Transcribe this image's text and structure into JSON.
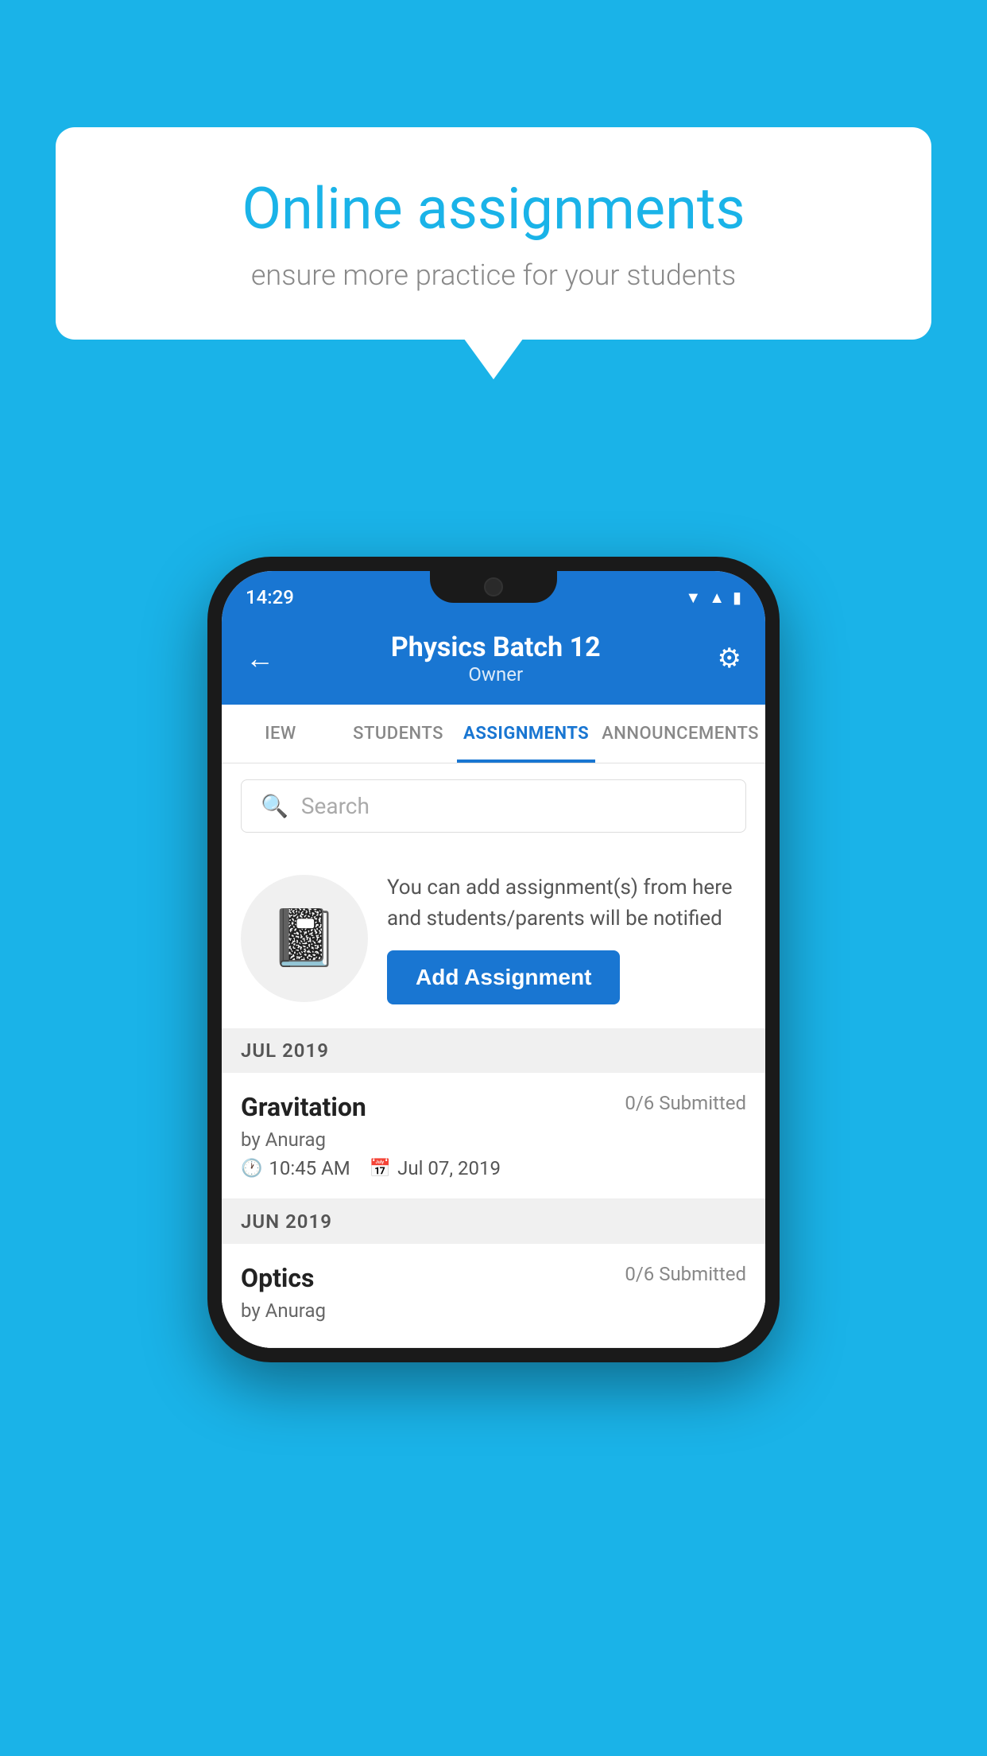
{
  "background_color": "#1ab3e8",
  "speech_bubble": {
    "title": "Online assignments",
    "subtitle": "ensure more practice for your students"
  },
  "phone": {
    "status_bar": {
      "time": "14:29",
      "icons": [
        "wifi",
        "signal",
        "battery"
      ]
    },
    "header": {
      "title": "Physics Batch 12",
      "subtitle": "Owner",
      "back_label": "←",
      "settings_label": "⚙"
    },
    "tabs": [
      {
        "label": "IEW",
        "active": false
      },
      {
        "label": "STUDENTS",
        "active": false
      },
      {
        "label": "ASSIGNMENTS",
        "active": true
      },
      {
        "label": "ANNOUNCEMENTS",
        "active": false
      }
    ],
    "search": {
      "placeholder": "Search"
    },
    "promo": {
      "text": "You can add assignment(s) from here and students/parents will be notified",
      "button_label": "Add Assignment"
    },
    "sections": [
      {
        "label": "JUL 2019",
        "assignments": [
          {
            "name": "Gravitation",
            "submitted": "0/6 Submitted",
            "by": "by Anurag",
            "time": "10:45 AM",
            "date": "Jul 07, 2019"
          }
        ]
      },
      {
        "label": "JUN 2019",
        "assignments": [
          {
            "name": "Optics",
            "submitted": "0/6 Submitted",
            "by": "by Anurag",
            "time": "",
            "date": ""
          }
        ]
      }
    ]
  }
}
